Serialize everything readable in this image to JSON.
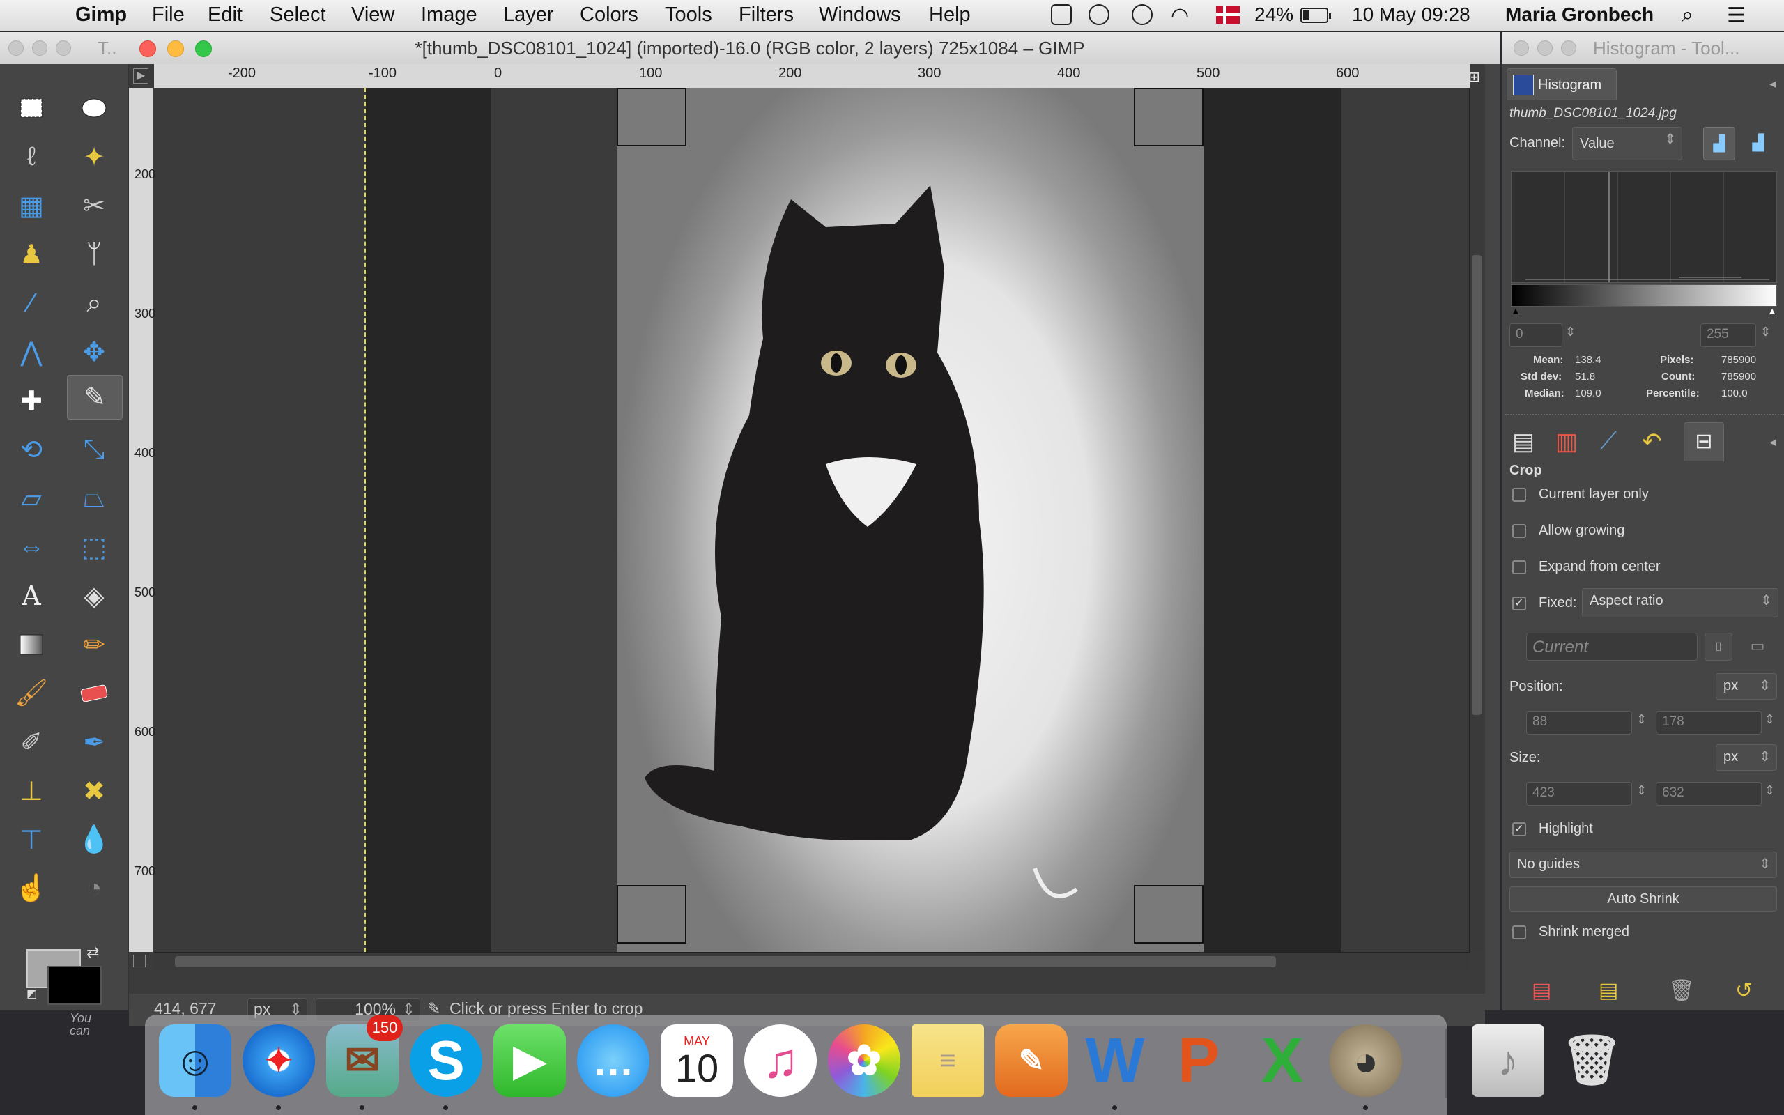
{
  "menubar": {
    "app_name": "Gimp",
    "items": [
      "File",
      "Edit",
      "Select",
      "View",
      "Image",
      "Layer",
      "Colors",
      "Tools",
      "Filters",
      "Windows",
      "Help"
    ],
    "battery": "24%",
    "datetime": "10 May  09:28",
    "user": "Maria Gronbech"
  },
  "window": {
    "title": "*[thumb_DSC08101_1024] (imported)-16.0 (RGB color, 2 layers) 725x1084 – GIMP",
    "ghost_tab": "T.."
  },
  "ruler": {
    "h_ticks": [
      "-200",
      "-100",
      "0",
      "100",
      "200",
      "300",
      "400",
      "500",
      "600"
    ],
    "v_ticks": [
      "200",
      "300",
      "400",
      "500",
      "600",
      "700"
    ]
  },
  "status": {
    "coords": "414, 677",
    "unit": "px",
    "zoom": "100%",
    "message": "Click or press Enter to crop",
    "toolbox_hint": "You can"
  },
  "panel": {
    "window_title": "Histogram - Tool...",
    "histogram_tab": "Histogram",
    "filename": "thumb_DSC08101_1024.jpg",
    "channel_label": "Channel:",
    "channel_value": "Value",
    "range_low": "0",
    "range_high": "255",
    "stats": {
      "mean_label": "Mean:",
      "mean": "138.4",
      "std_label": "Std dev:",
      "std": "51.8",
      "median_label": "Median:",
      "median": "109.0",
      "pixels_label": "Pixels:",
      "pixels": "785900",
      "count_label": "Count:",
      "count": "785900",
      "percentile_label": "Percentile:",
      "percentile": "100.0"
    },
    "tool_options": {
      "title": "Crop",
      "current_layer_only": "Current layer only",
      "allow_growing": "Allow growing",
      "expand_from_center": "Expand from center",
      "fixed_label": "Fixed:",
      "fixed_value": "Aspect ratio",
      "ratio_placeholder": "Current",
      "position_label": "Position:",
      "position_unit": "px",
      "position_x": "88",
      "position_y": "178",
      "size_label": "Size:",
      "size_unit": "px",
      "size_w": "423",
      "size_h": "632",
      "highlight": "Highlight",
      "guides_value": "No guides",
      "auto_shrink": "Auto Shrink",
      "shrink_merged": "Shrink merged"
    }
  },
  "dock": {
    "mail_badge": "150",
    "calendar_month": "MAY",
    "calendar_day": "10"
  }
}
